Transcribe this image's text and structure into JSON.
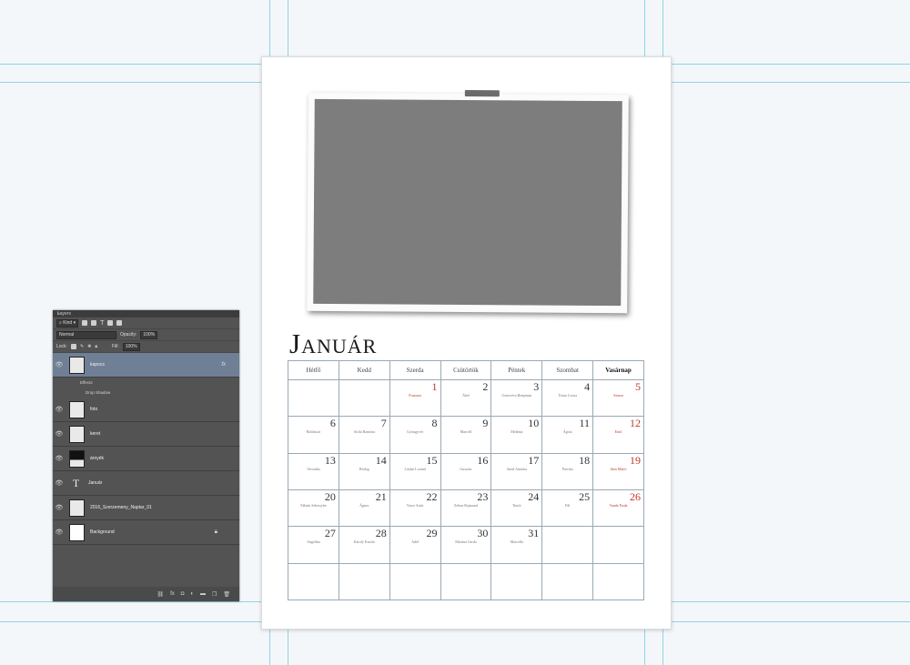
{
  "calendar": {
    "month": "Január",
    "month_first": "J",
    "month_rest": "ANUÁR",
    "weekdays": [
      "Hétfő",
      "Kedd",
      "Szerda",
      "Csütörtök",
      "Péntek",
      "Szombat",
      "Vasárnap"
    ],
    "weeks": [
      [
        {
          "d": "",
          "n": ""
        },
        {
          "d": "",
          "n": ""
        },
        {
          "d": "1",
          "n": "Fruzsina",
          "hol": true
        },
        {
          "d": "2",
          "n": "Ábel"
        },
        {
          "d": "3",
          "n": "Genovéva Benjámin"
        },
        {
          "d": "4",
          "n": "Titusz Leona"
        },
        {
          "d": "5",
          "n": "Simon",
          "hol": true
        }
      ],
      [
        {
          "d": "6",
          "n": "Boldizsár"
        },
        {
          "d": "7",
          "n": "Attila Ramóna"
        },
        {
          "d": "8",
          "n": "Gyöngyvér"
        },
        {
          "d": "9",
          "n": "Marcell"
        },
        {
          "d": "10",
          "n": "Melánia"
        },
        {
          "d": "11",
          "n": "Ágota"
        },
        {
          "d": "12",
          "n": "Ernő",
          "hol": true
        }
      ],
      [
        {
          "d": "13",
          "n": "Veronika"
        },
        {
          "d": "14",
          "n": "Bódog"
        },
        {
          "d": "15",
          "n": "Lóránt Loránd"
        },
        {
          "d": "16",
          "n": "Gusztáv"
        },
        {
          "d": "17",
          "n": "Antal Antónia"
        },
        {
          "d": "18",
          "n": "Piroska"
        },
        {
          "d": "19",
          "n": "Sára Márió",
          "hol": true
        }
      ],
      [
        {
          "d": "20",
          "n": "Fábián Sebestyén"
        },
        {
          "d": "21",
          "n": "Ágnes"
        },
        {
          "d": "22",
          "n": "Vince Artúr"
        },
        {
          "d": "23",
          "n": "Zelma Rajmund"
        },
        {
          "d": "24",
          "n": "Timót"
        },
        {
          "d": "25",
          "n": "Pál"
        },
        {
          "d": "26",
          "n": "Vanda Paula",
          "hol": true
        }
      ],
      [
        {
          "d": "27",
          "n": "Angelika"
        },
        {
          "d": "28",
          "n": "Károly Karola"
        },
        {
          "d": "29",
          "n": "Adél"
        },
        {
          "d": "30",
          "n": "Martina Gerda"
        },
        {
          "d": "31",
          "n": "Marcella"
        },
        {
          "d": "",
          "n": ""
        },
        {
          "d": "",
          "n": ""
        }
      ],
      [
        {
          "d": "",
          "n": ""
        },
        {
          "d": "",
          "n": ""
        },
        {
          "d": "",
          "n": ""
        },
        {
          "d": "",
          "n": ""
        },
        {
          "d": "",
          "n": ""
        },
        {
          "d": "",
          "n": ""
        },
        {
          "d": "",
          "n": ""
        }
      ]
    ]
  },
  "layers_panel": {
    "title": "Layers",
    "filter_label": "Kind",
    "blend_mode": "Normal",
    "opacity_label": "Opacity:",
    "opacity_value": "100%",
    "lock_label": "Lock:",
    "fill_label": "Fill:",
    "fill_value": "100%",
    "layers": [
      {
        "name": "kapocs",
        "fx": "fx",
        "selected": true,
        "thumb": "checker"
      },
      {
        "name": "foto",
        "thumb": "checker"
      },
      {
        "name": "keret",
        "thumb": "checker"
      },
      {
        "name": "árnyék",
        "thumb": "dark"
      },
      {
        "name": "Január",
        "thumb": "text"
      },
      {
        "name": "2016_Szerzemeny_Naptar_01",
        "thumb": "checker"
      },
      {
        "name": "Background",
        "thumb": "white",
        "locked": true
      }
    ],
    "effects_label": "Effects",
    "drop_shadow_label": "Drop Shadow"
  },
  "colors": {
    "guide": "#8fd3e6",
    "holiday": "#c0392b",
    "panel_bg": "#535353",
    "selected_layer": "#6f7f96"
  }
}
